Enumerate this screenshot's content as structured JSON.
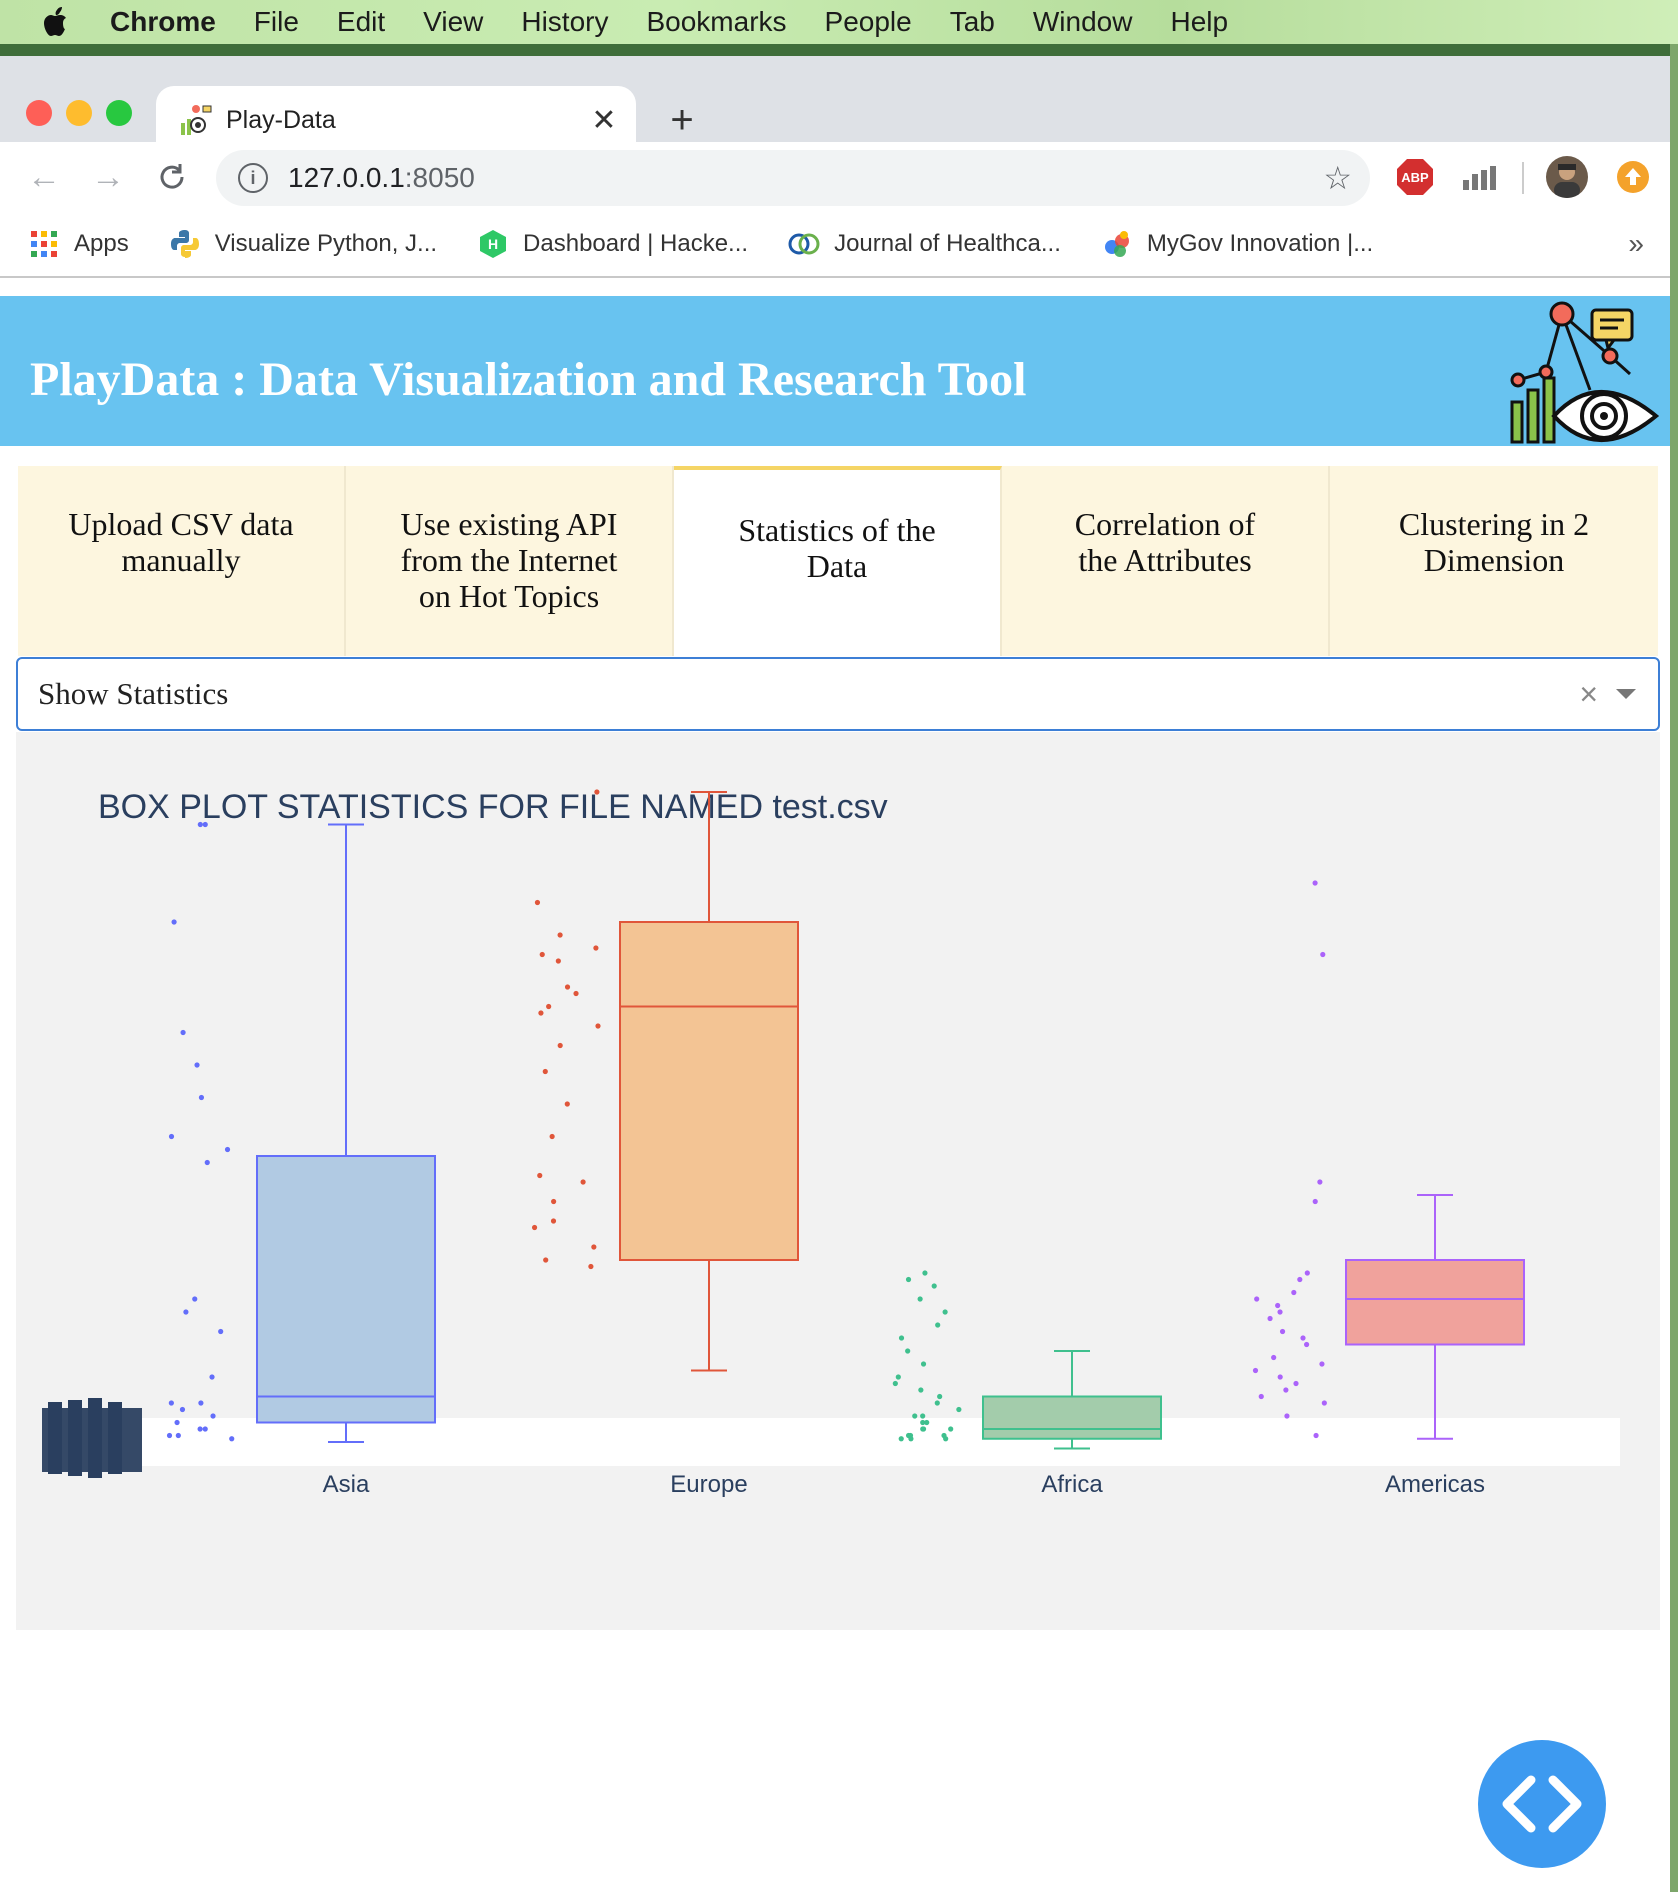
{
  "menubar": {
    "app_name": "Chrome",
    "items": [
      "File",
      "Edit",
      "View",
      "History",
      "Bookmarks",
      "People",
      "Tab",
      "Window",
      "Help"
    ]
  },
  "browser": {
    "tab_title": "Play-Data",
    "url_host": "127.0.0.1",
    "url_port": ":8050",
    "bookmarks": [
      {
        "label": "Apps",
        "icon": "apps-grid-icon"
      },
      {
        "label": "Visualize Python, J...",
        "icon": "python-icon"
      },
      {
        "label": "Dashboard | Hacke...",
        "icon": "hackerrank-icon"
      },
      {
        "label": "Journal of Healthca...",
        "icon": "journal-icon"
      },
      {
        "label": "MyGov Innovation |...",
        "icon": "mygov-icon"
      }
    ],
    "bookmarks_more": "»",
    "extension_abp": "ABP"
  },
  "page": {
    "header_title": "PlayData : Data Visualization and Research Tool",
    "tabs": [
      {
        "label": "Upload CSV data manually",
        "lines": [
          "Upload CSV data",
          "manually"
        ]
      },
      {
        "label": "Use existing API from the Internet on Hot Topics",
        "lines": [
          "Use existing API",
          "from the Internet",
          "on Hot Topics"
        ]
      },
      {
        "label": "Statistics of the Data",
        "lines": [
          "Statistics of the",
          "Data"
        ]
      },
      {
        "label": "Correlation of the Attributes",
        "lines": [
          "Correlation of",
          "the Attributes"
        ]
      },
      {
        "label": "Clustering in 2 Dimension",
        "lines": [
          "Clustering in 2",
          "Dimension"
        ]
      }
    ],
    "active_tab": 2,
    "dropdown_value": "Show Statistics",
    "dropdown_clear": "×"
  },
  "chart_data": {
    "type": "box",
    "title": "BOX PLOT STATISTICS FOR FILE NAMED test.csv",
    "categories": [
      "Asia",
      "Europe",
      "Africa",
      "Americas"
    ],
    "colors": {
      "Asia": {
        "line": "#636efa",
        "fill": "#b1cae3"
      },
      "Europe": {
        "line": "#e0563a",
        "fill": "#f3c494"
      },
      "Africa": {
        "line": "#3fc08e",
        "fill": "#a3ccab"
      },
      "Americas": {
        "line": "#ab63fa",
        "fill": "#f0a29c"
      }
    },
    "ylim": [
      0,
      100
    ],
    "boxes": [
      {
        "name": "Asia",
        "lower_fence": 0,
        "q1": 3,
        "median": 7,
        "q3": 44,
        "upper_fence": 95
      },
      {
        "name": "Europe",
        "lower_fence": 11,
        "q1": 28,
        "median": 67,
        "q3": 80,
        "upper_fence": 100
      },
      {
        "name": "Africa",
        "lower_fence": -1,
        "q1": 0.5,
        "median": 2,
        "q3": 7,
        "upper_fence": 14
      },
      {
        "name": "Americas",
        "lower_fence": 0.5,
        "q1": 15,
        "median": 22,
        "q3": 28,
        "upper_fence": 38
      }
    ],
    "points": {
      "Asia": [
        95,
        95,
        80,
        63,
        58,
        53,
        47,
        45,
        43,
        22,
        20,
        17,
        10,
        6,
        6,
        5,
        4,
        3,
        2,
        2,
        1,
        1,
        0.5
      ],
      "Europe": [
        100,
        83,
        78,
        76,
        75,
        74,
        70,
        69,
        67,
        66,
        64,
        61,
        57,
        52,
        47,
        41,
        40,
        37,
        34,
        33,
        30,
        28,
        27
      ],
      "Africa": [
        26,
        25,
        24,
        22,
        20,
        18,
        16,
        14,
        12,
        10,
        9,
        8,
        7,
        6,
        5,
        4,
        4,
        3,
        3,
        2,
        2,
        2,
        1,
        1,
        1,
        0.5,
        0.5,
        0.5
      ],
      "Americas": [
        86,
        75,
        40,
        37,
        26,
        25,
        23,
        22,
        21,
        20,
        19,
        17,
        16,
        15,
        13,
        12,
        11,
        10,
        9,
        8,
        7,
        6,
        4,
        1
      ]
    }
  }
}
